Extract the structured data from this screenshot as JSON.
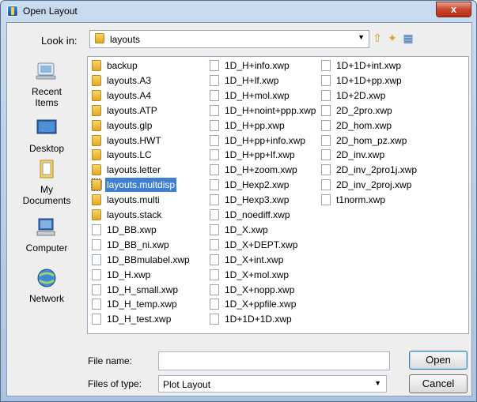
{
  "window": {
    "title": "Open Layout",
    "close_label": "x"
  },
  "lookin": {
    "label": "Look in:",
    "value": "layouts"
  },
  "places": [
    {
      "name": "recent-items",
      "label1": "Recent",
      "label2": "Items"
    },
    {
      "name": "desktop",
      "label1": "Desktop",
      "label2": ""
    },
    {
      "name": "my-documents",
      "label1": "My",
      "label2": "Documents"
    },
    {
      "name": "computer",
      "label1": "Computer",
      "label2": ""
    },
    {
      "name": "network",
      "label1": "Network",
      "label2": ""
    }
  ],
  "columns": [
    [
      {
        "name": "backup",
        "type": "folder"
      },
      {
        "name": "layouts.A3",
        "type": "folder"
      },
      {
        "name": "layouts.A4",
        "type": "folder"
      },
      {
        "name": "layouts.ATP",
        "type": "folder"
      },
      {
        "name": "layouts.glp",
        "type": "folder"
      },
      {
        "name": "layouts.HWT",
        "type": "folder"
      },
      {
        "name": "layouts.LC",
        "type": "folder"
      },
      {
        "name": "layouts.letter",
        "type": "folder"
      },
      {
        "name": "layouts.multdisp",
        "type": "folder",
        "selected": true
      },
      {
        "name": "layouts.multi",
        "type": "folder"
      },
      {
        "name": "layouts.stack",
        "type": "folder"
      },
      {
        "name": "1D_BB.xwp",
        "type": "file"
      },
      {
        "name": "1D_BB_ni.xwp",
        "type": "file"
      },
      {
        "name": "1D_BBmulabel.xwp",
        "type": "file"
      },
      {
        "name": "1D_H.xwp",
        "type": "file"
      },
      {
        "name": "1D_H_small.xwp",
        "type": "file"
      },
      {
        "name": "1D_H_temp.xwp",
        "type": "file"
      },
      {
        "name": "1D_H_test.xwp",
        "type": "file"
      }
    ],
    [
      {
        "name": "1D_H+info.xwp",
        "type": "file"
      },
      {
        "name": "1D_H+lf.xwp",
        "type": "file"
      },
      {
        "name": "1D_H+mol.xwp",
        "type": "file"
      },
      {
        "name": "1D_H+noint+ppp.xwp",
        "type": "file"
      },
      {
        "name": "1D_H+pp.xwp",
        "type": "file"
      },
      {
        "name": "1D_H+pp+info.xwp",
        "type": "file"
      },
      {
        "name": "1D_H+pp+lf.xwp",
        "type": "file"
      },
      {
        "name": "1D_H+zoom.xwp",
        "type": "file"
      },
      {
        "name": "1D_Hexp2.xwp",
        "type": "file"
      },
      {
        "name": "1D_Hexp3.xwp",
        "type": "file"
      },
      {
        "name": "1D_noediff.xwp",
        "type": "file"
      },
      {
        "name": "1D_X.xwp",
        "type": "file"
      },
      {
        "name": "1D_X+DEPT.xwp",
        "type": "file"
      },
      {
        "name": "1D_X+int.xwp",
        "type": "file"
      },
      {
        "name": "1D_X+mol.xwp",
        "type": "file"
      },
      {
        "name": "1D_X+nopp.xwp",
        "type": "file"
      },
      {
        "name": "1D_X+ppfile.xwp",
        "type": "file"
      },
      {
        "name": "1D+1D+1D.xwp",
        "type": "file"
      }
    ],
    [
      {
        "name": "1D+1D+int.xwp",
        "type": "file"
      },
      {
        "name": "1D+1D+pp.xwp",
        "type": "file"
      },
      {
        "name": "1D+2D.xwp",
        "type": "file"
      },
      {
        "name": "2D_2pro.xwp",
        "type": "file"
      },
      {
        "name": "2D_hom.xwp",
        "type": "file"
      },
      {
        "name": "2D_hom_pz.xwp",
        "type": "file"
      },
      {
        "name": "2D_inv.xwp",
        "type": "file"
      },
      {
        "name": "2D_inv_2pro1j.xwp",
        "type": "file"
      },
      {
        "name": "2D_inv_2proj.xwp",
        "type": "file"
      },
      {
        "name": "t1norm.xwp",
        "type": "file"
      }
    ]
  ],
  "filename": {
    "label": "File name:",
    "value": ""
  },
  "filetype": {
    "label": "Files of type:",
    "value": "Plot Layout"
  },
  "buttons": {
    "open": "Open",
    "cancel": "Cancel"
  }
}
